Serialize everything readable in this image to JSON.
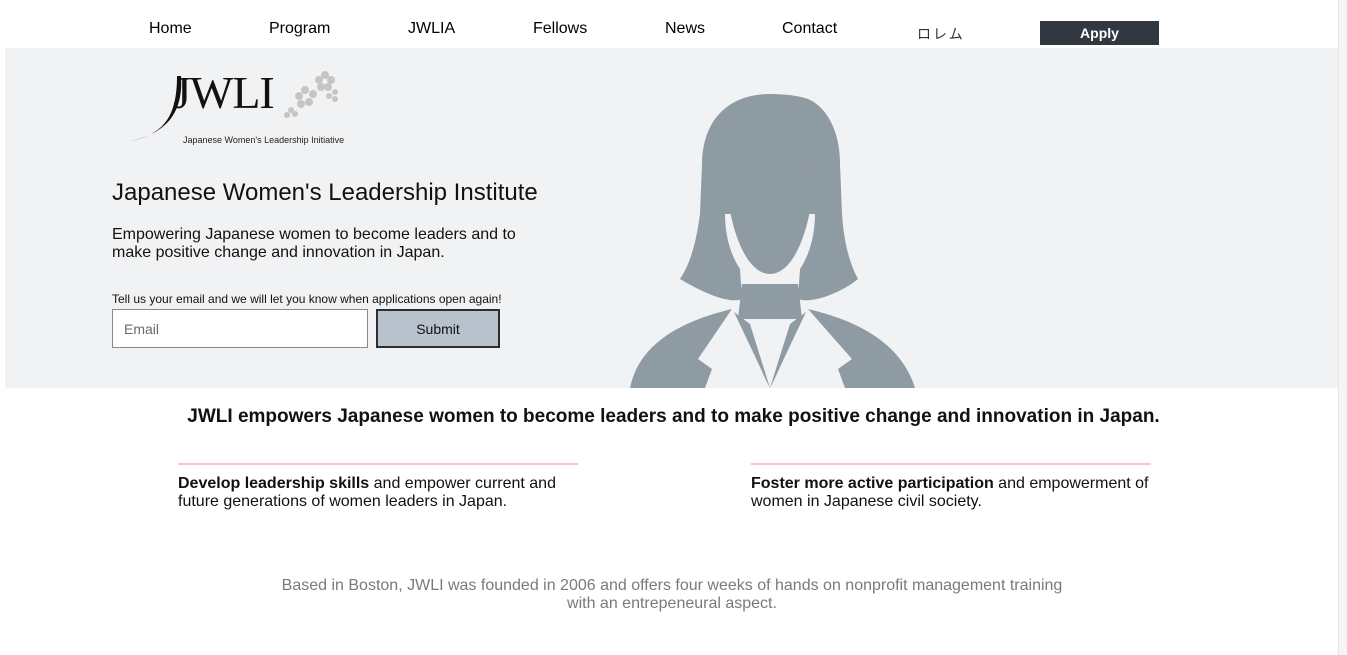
{
  "nav": {
    "items": [
      "Home",
      "Program",
      "JWLIA",
      "Fellows",
      "News",
      "Contact"
    ],
    "language_label": "ロレム",
    "apply_label": "Apply"
  },
  "hero": {
    "logo_text": "JWLI",
    "logo_subtitle": "Japanese Women's Leadership Initiative",
    "title": "Japanese Women's Leadership Institute",
    "description": "Empowering Japanese women to become leaders and to make positive change and innovation in Japan.",
    "email_prompt": "Tell us your email and we will let you know when applications open again!",
    "email_placeholder": "Email",
    "submit_label": "Submit"
  },
  "mission": {
    "headline": "JWLI empowers Japanese women to become leaders and to make positive change and innovation in Japan.",
    "goals": [
      {
        "strong": "Develop leadership skills",
        "rest": " and empower current and future generations of women leaders in Japan."
      },
      {
        "strong": "Foster more active participation",
        "rest": " and empowerment of women in Japanese civil society."
      }
    ],
    "about": "Based in Boston, JWLI was founded in 2006 and offers four weeks of hands on nonprofit management training with an entrepeneural aspect."
  },
  "colors": {
    "hero_bg": "#f1f2f4",
    "apply_bg": "#323840",
    "submit_bg": "#b7c2cc",
    "silhouette": "#8f9ba3",
    "goal_rule": "#f2c4d6",
    "about_text": "#7a7a7a"
  }
}
